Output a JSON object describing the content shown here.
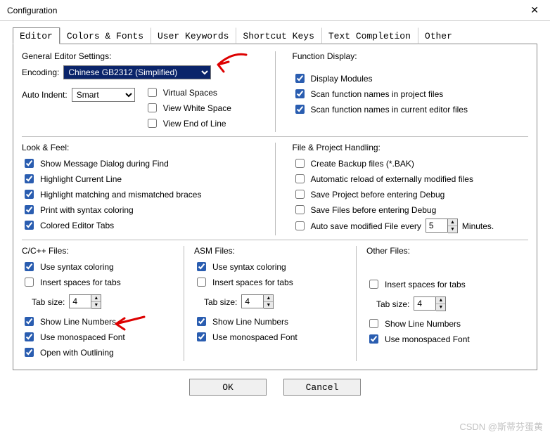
{
  "window": {
    "title": "Configuration"
  },
  "tabs": [
    "Editor",
    "Colors & Fonts",
    "User Keywords",
    "Shortcut Keys",
    "Text Completion",
    "Other"
  ],
  "general": {
    "header": "General Editor Settings:",
    "encoding_label": "Encoding:",
    "encoding_value": "Chinese GB2312 (Simplified)",
    "auto_indent_label": "Auto Indent:",
    "auto_indent_value": "Smart",
    "virtual_spaces": "Virtual Spaces",
    "view_white_space": "View White Space",
    "view_eol": "View End of Line"
  },
  "func": {
    "header": "Function Display:",
    "display_modules": "Display Modules",
    "scan_project": "Scan function names in project files",
    "scan_editor": "Scan function names in current editor files"
  },
  "look": {
    "header": "Look & Feel:",
    "show_msg": "Show Message Dialog during Find",
    "hl_line": "Highlight Current Line",
    "hl_braces": "Highlight matching and mismatched braces",
    "print_syntax": "Print with syntax coloring",
    "colored_tabs": "Colored Editor Tabs"
  },
  "fileproj": {
    "header": "File & Project Handling:",
    "backup": "Create Backup files (*.BAK)",
    "autoreload": "Automatic reload of externally modified files",
    "save_proj": "Save Project before entering Debug",
    "save_files": "Save Files before entering Debug",
    "autosave": "Auto save modified File every",
    "autosave_val": "5",
    "autosave_unit": "Minutes."
  },
  "ccpp": {
    "header": "C/C++ Files:",
    "syntax": "Use syntax coloring",
    "insert_spaces": "Insert spaces for tabs",
    "tab_label": "Tab size:",
    "tab_val": "4",
    "line_nums": "Show Line Numbers",
    "mono": "Use monospaced Font",
    "outlining": "Open with Outlining"
  },
  "asm": {
    "header": "ASM Files:",
    "syntax": "Use syntax coloring",
    "insert_spaces": "Insert spaces for tabs",
    "tab_label": "Tab size:",
    "tab_val": "4",
    "line_nums": "Show Line Numbers",
    "mono": "Use monospaced Font"
  },
  "other": {
    "header": "Other Files:",
    "insert_spaces": "Insert spaces for tabs",
    "tab_label": "Tab size:",
    "tab_val": "4",
    "line_nums": "Show Line Numbers",
    "mono": "Use monospaced Font"
  },
  "buttons": {
    "ok": "OK",
    "cancel": "Cancel"
  },
  "watermark": "CSDN @斯蒂芬蛋黄"
}
